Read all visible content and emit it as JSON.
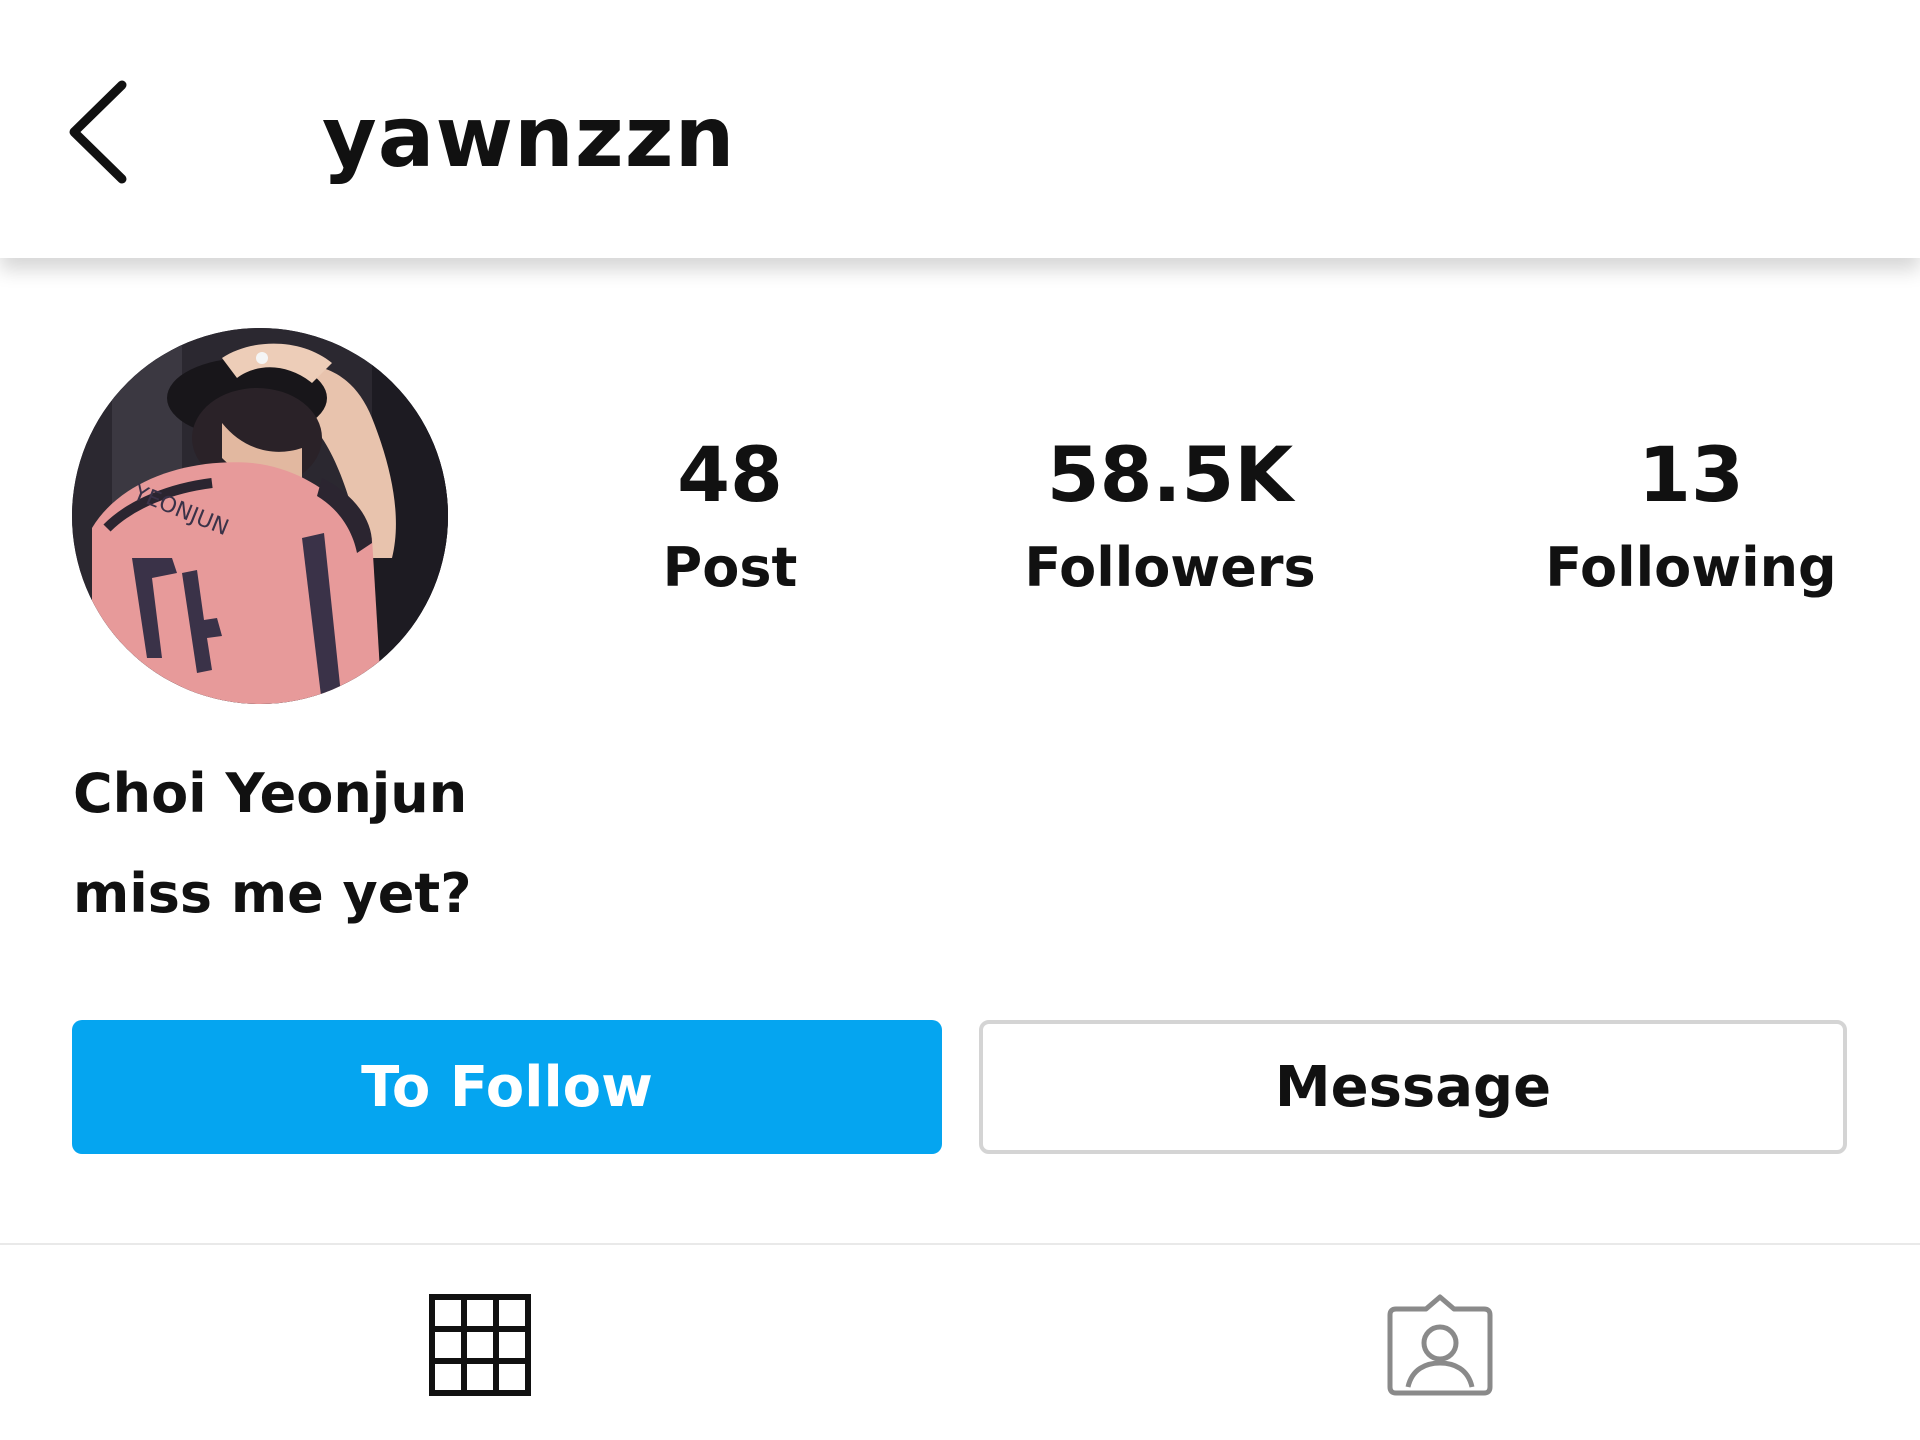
{
  "header": {
    "back_icon": "chevron-left-icon",
    "username": "yawnzzn"
  },
  "profile": {
    "avatar_jersey_text": "YEONJUN",
    "avatar_jersey_number": "24",
    "stats": [
      {
        "value": "48",
        "label": "Post"
      },
      {
        "value": "58.5K",
        "label": "Followers"
      },
      {
        "value": "13",
        "label": "Following"
      }
    ],
    "name": "Choi Yeonjun",
    "bio": "miss me yet?"
  },
  "actions": {
    "follow_label": "To Follow",
    "message_label": "Message"
  },
  "tabs": {
    "grid_icon": "grid-icon",
    "tagged_icon": "tagged-person-icon"
  },
  "colors": {
    "follow_button": "#05a5f0",
    "jersey": "#e79a9a",
    "background": "#ffffff"
  }
}
